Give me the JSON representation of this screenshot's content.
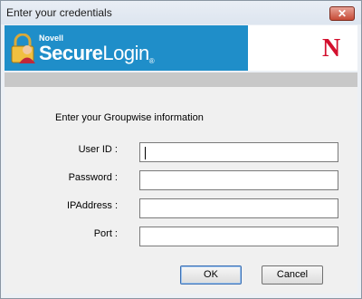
{
  "window": {
    "title": "Enter your credentials",
    "close_glyph": "✕"
  },
  "banner": {
    "company": "Novell",
    "product_prefix": "Secure",
    "product_suffix": "Login",
    "registered": "®",
    "logo_letter": "N",
    "brand_color": "#1f8ec9",
    "logo_color": "#d3102e"
  },
  "form": {
    "heading": "Enter your Groupwise information",
    "fields": [
      {
        "label": "User ID :",
        "value": ""
      },
      {
        "label": "Password :",
        "value": ""
      },
      {
        "label": "IPAddress :",
        "value": ""
      },
      {
        "label": "Port :",
        "value": ""
      }
    ]
  },
  "buttons": {
    "ok": "OK",
    "cancel": "Cancel"
  }
}
